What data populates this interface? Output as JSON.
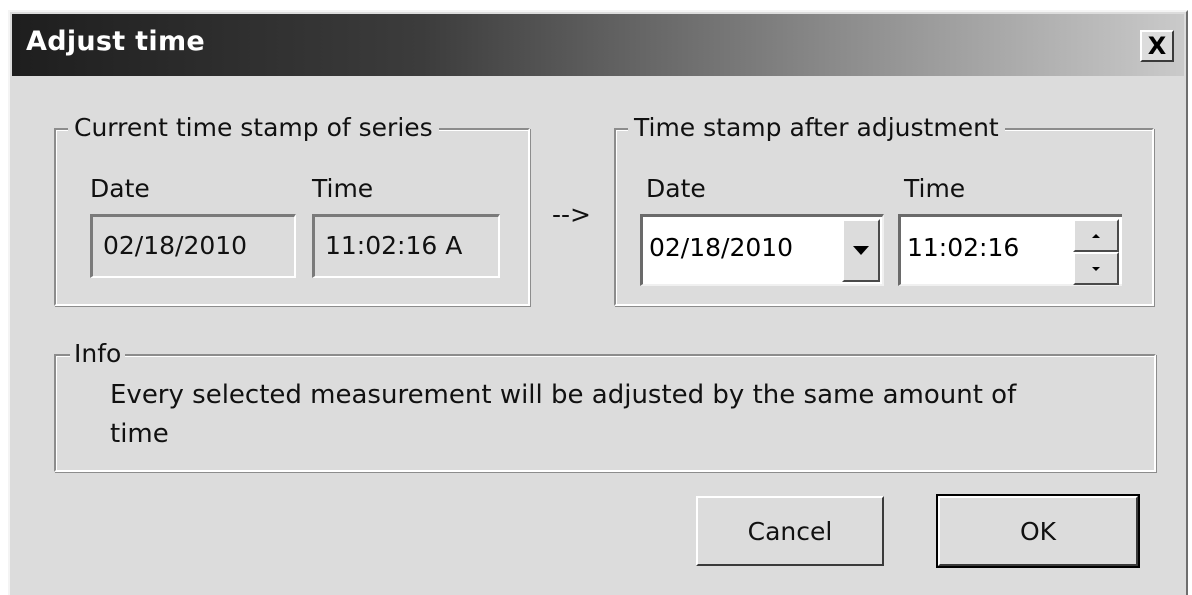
{
  "window": {
    "title": "Adjust time",
    "close_glyph": "X"
  },
  "current": {
    "legend": "Current time stamp of series",
    "date_label": "Date",
    "time_label": "Time",
    "date_value": "02/18/2010",
    "time_value": "11:02:16 A"
  },
  "arrow": "-->",
  "adjusted": {
    "legend": "Time stamp after adjustment",
    "date_label": "Date",
    "time_label": "Time",
    "date_value": "02/18/2010",
    "time_value": "11:02:16"
  },
  "info": {
    "legend": "Info",
    "line1": "Every selected measurement will be adjusted by the same amount of",
    "line2": "time"
  },
  "buttons": {
    "cancel": "Cancel",
    "ok": "OK"
  },
  "colors": {
    "dialog_bg": "#dcdcdc",
    "title_start": "#1e1e1e",
    "title_end": "#cacaca"
  },
  "icons": {
    "close": "close-icon",
    "dropdown": "chevron-down-icon",
    "spin_up": "spin-up-icon",
    "spin_down": "spin-down-icon"
  }
}
